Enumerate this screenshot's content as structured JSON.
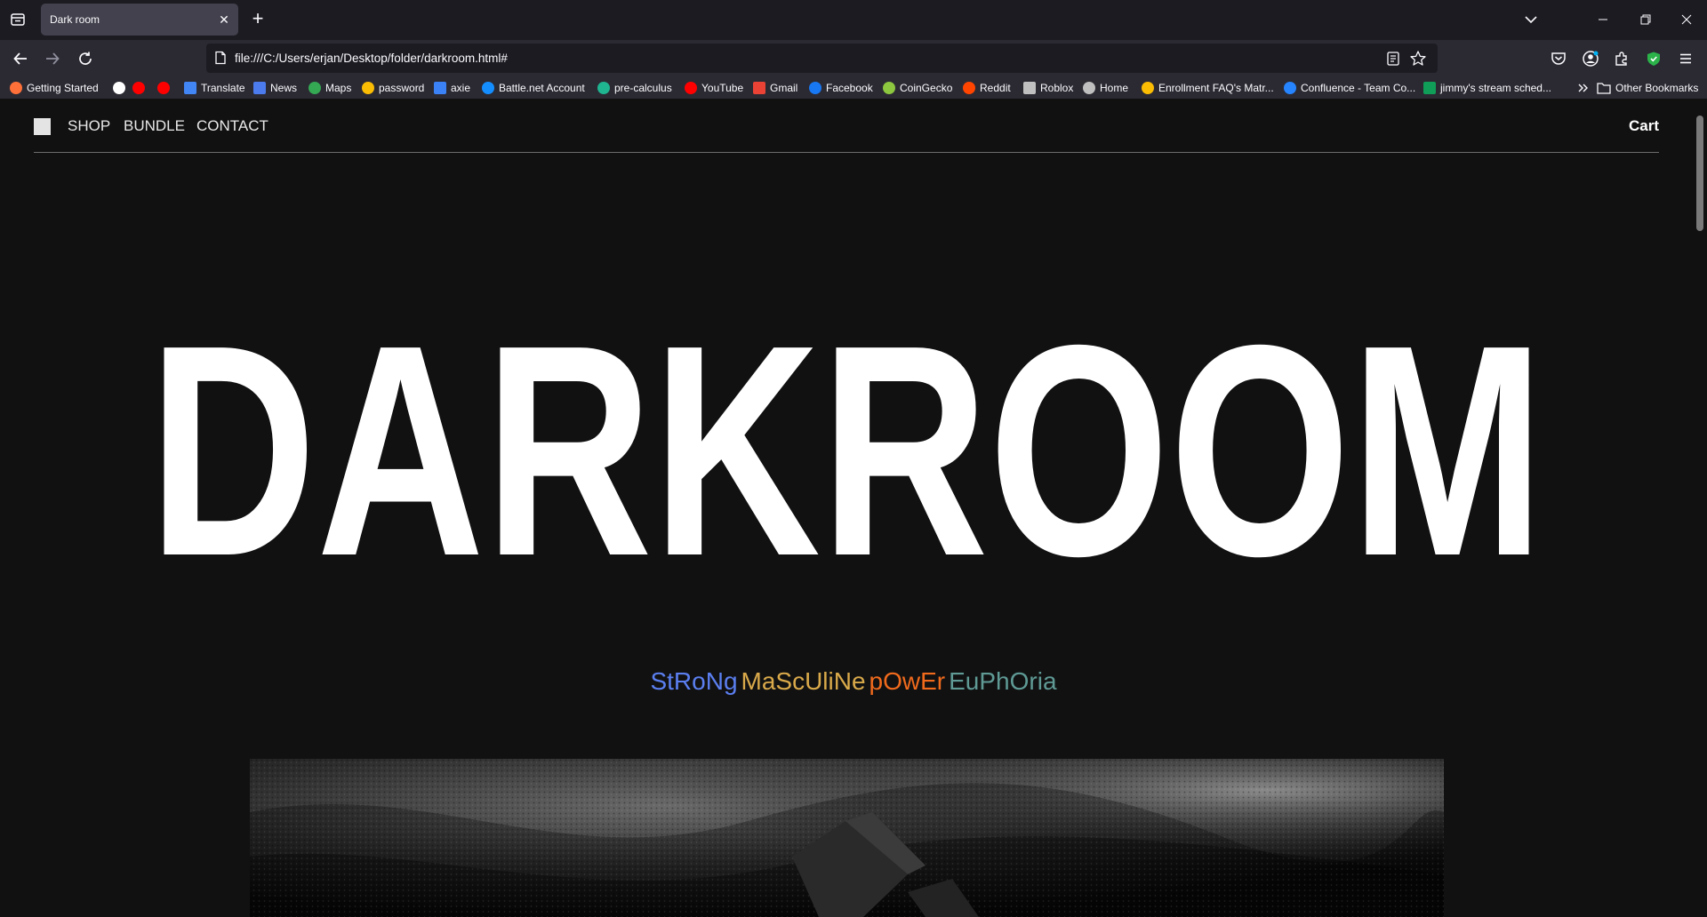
{
  "browser": {
    "tab_title": "Dark room",
    "url": "file:///C:/Users/erjan/Desktop/folder/darkroom.html#",
    "bookmarks": [
      {
        "label": "Getting Started",
        "icon": "firefox-icon",
        "color": "#ff7139"
      },
      {
        "label": "",
        "icon": "google-icon",
        "color": "#ffffff"
      },
      {
        "label": "",
        "icon": "youtube-icon",
        "color": "#ff0000"
      },
      {
        "label": "",
        "icon": "youtube-icon",
        "color": "#ff0000"
      },
      {
        "label": "Translate",
        "icon": "translate-icon",
        "color": "#4285f4"
      },
      {
        "label": "News",
        "icon": "news-icon",
        "color": "#4b7bec"
      },
      {
        "label": "Maps",
        "icon": "maps-icon",
        "color": "#34a853"
      },
      {
        "label": "password",
        "icon": "drive-icon",
        "color": "#fbbc04"
      },
      {
        "label": "axie",
        "icon": "axie-icon",
        "color": "#3b82f6"
      },
      {
        "label": "Battle.net Account",
        "icon": "battlenet-icon",
        "color": "#148eff"
      },
      {
        "label": "pre-calculus",
        "icon": "precalc-icon",
        "color": "#1fb591"
      },
      {
        "label": "YouTube",
        "icon": "youtube-icon",
        "color": "#ff0000"
      },
      {
        "label": "Gmail",
        "icon": "gmail-icon",
        "color": "#ea4335"
      },
      {
        "label": "Facebook",
        "icon": "facebook-icon",
        "color": "#1877f2"
      },
      {
        "label": "CoinGecko",
        "icon": "coingecko-icon",
        "color": "#8dc63f"
      },
      {
        "label": "Reddit",
        "icon": "reddit-icon",
        "color": "#ff4500"
      },
      {
        "label": "Roblox",
        "icon": "roblox-icon",
        "color": "#c0c0c0"
      },
      {
        "label": "Home",
        "icon": "home-icon",
        "color": "#bfbfbf"
      },
      {
        "label": "Enrollment FAQ's Matr...",
        "icon": "drive-icon",
        "color": "#fbbc04"
      },
      {
        "label": "Confluence - Team Co...",
        "icon": "confluence-icon",
        "color": "#2684ff"
      },
      {
        "label": "jimmy's stream sched...",
        "icon": "sheets-icon",
        "color": "#0f9d58"
      }
    ],
    "other_bookmarks": "Other Bookmarks"
  },
  "site": {
    "nav": [
      "SHOP",
      "BUNDLE",
      "CONTACT"
    ],
    "cart": "Cart",
    "hero_title": "DARKROOM",
    "tagline": [
      {
        "text": "StRoNg",
        "color": "#5b7ff0"
      },
      {
        "text": "MaScUliNe",
        "color": "#d9a94a"
      },
      {
        "text": "pOwEr",
        "color": "#f06a1c"
      },
      {
        "text": "EuPhOria",
        "color": "#5f9a95"
      }
    ]
  },
  "colors": {
    "page_bg": "#111112",
    "browser_chrome": "#2b2a33",
    "tabstrip": "#1c1b22"
  }
}
